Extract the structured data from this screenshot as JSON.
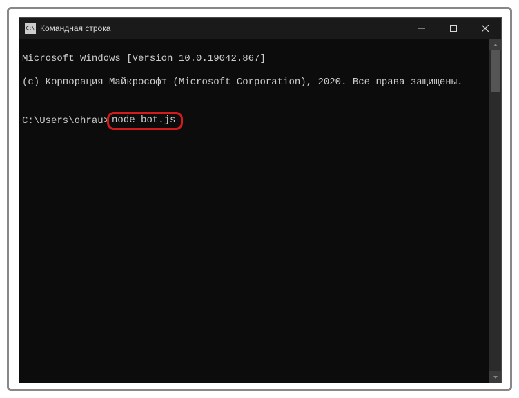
{
  "window": {
    "title": "Командная строка"
  },
  "terminal": {
    "line1": "Microsoft Windows [Version 10.0.19042.867]",
    "line2": "(c) Корпорация Майкрософт (Microsoft Corporation), 2020. Все права защищены.",
    "blank": "",
    "prompt": "C:\\Users\\ohrau>",
    "command": "node bot.js"
  }
}
